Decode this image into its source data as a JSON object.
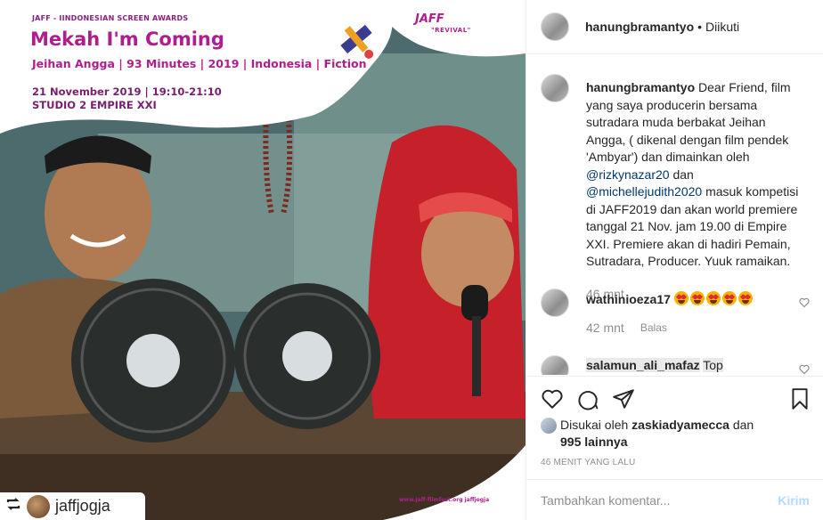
{
  "poster": {
    "org": "JAFF - IINDONESIAN SCREEN AWARDS",
    "title": "Mekah I'm Coming",
    "meta": "Jeihan Angga | 93 Minutes | 2019 | Indonesia | Fiction",
    "date": "21 November 2019 | 19:10-21:10",
    "venue": "STUDIO 2 EMPIRE XXI",
    "logo": "JAFF",
    "logo_sub": "\"REVIVAL\"",
    "footer": "www.jaff-filmfest.org   jaffjogja"
  },
  "repost": {
    "icon": "repost-icon",
    "username": "jaffjogja"
  },
  "header": {
    "username": "hanungbramantyo",
    "separator": "•",
    "follow_status": "Diikuti"
  },
  "caption": {
    "username": "hanungbramantyo",
    "text_1": "Dear Friend, film yang saya producerin bersama sutradara muda berbakat Jeihan Angga, ( dikenal dengan film pendek 'Ambyar') dan dimainkan oleh",
    "mention_1": "@rizkynazar20",
    "text_2": "dan",
    "mention_2": "@michellejudith2020",
    "text_3": "masuk kompetisi di JAFF2019 dan akan world premiere tanggal 21 Nov. jam 19.00 di Empire XXI. Premiere akan di hadiri Pemain, Sutradara, Producer. Yuuk ramaikan.",
    "time": "46 mnt"
  },
  "comments": [
    {
      "username": "wathinioeza17",
      "emoji_count": 5,
      "emoji": "heart-eyes-emoji",
      "time": "42 mnt",
      "reply_label": "Balas"
    },
    {
      "username": "salamun_ali_mafaz",
      "text": "Top"
    }
  ],
  "actions": {
    "like": "heart-icon",
    "comment": "comment-icon",
    "share": "share-icon",
    "save": "bookmark-icon"
  },
  "likes": {
    "prefix": "Disukai oleh",
    "user": "zaskiadyamecca",
    "and": "dan",
    "others": "995 lainnya"
  },
  "timestamp": "46 MENIT YANG LALU",
  "add_comment": {
    "placeholder": "Tambahkan komentar...",
    "post_label": "Kirim"
  },
  "colors": {
    "brand_magenta": "#b01e8e",
    "link_blue": "#00376b",
    "muted": "#8e8e8e",
    "post_disabled": "#b3dbff"
  }
}
